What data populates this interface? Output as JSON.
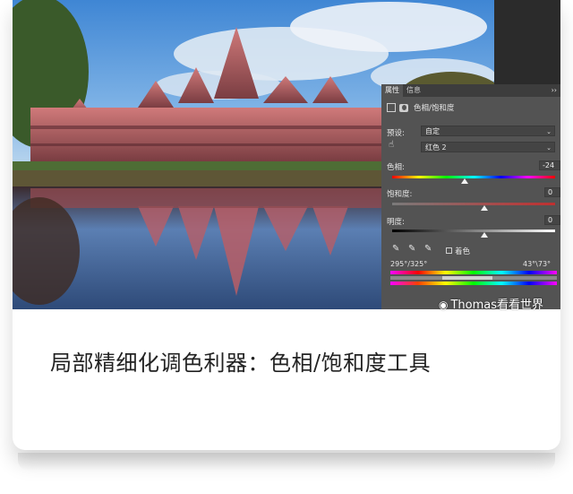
{
  "panel": {
    "tabs": [
      "属性",
      "信息"
    ],
    "menu_glyph": "››",
    "adjustment_title": "色相/饱和度",
    "preset_label": "预设:",
    "preset_value": "自定",
    "channel_value": "红色 2",
    "hue_label": "色相:",
    "hue_value": "-24",
    "saturation_label": "饱和度:",
    "saturation_value": "0",
    "lightness_label": "明度:",
    "lightness_value": "0",
    "colorize_label": "着色",
    "range_left": "295°/325°",
    "range_right": "43°\\73°"
  },
  "watermark": {
    "text": "Thomas看看世界",
    "icon": "weibo-icon"
  },
  "caption": "局部精细化调色利器：色相/饱和度工具",
  "colors": {
    "panel_bg": "#535353",
    "panel_tab_bg": "#3d3d3d",
    "caption_text": "#222222"
  }
}
